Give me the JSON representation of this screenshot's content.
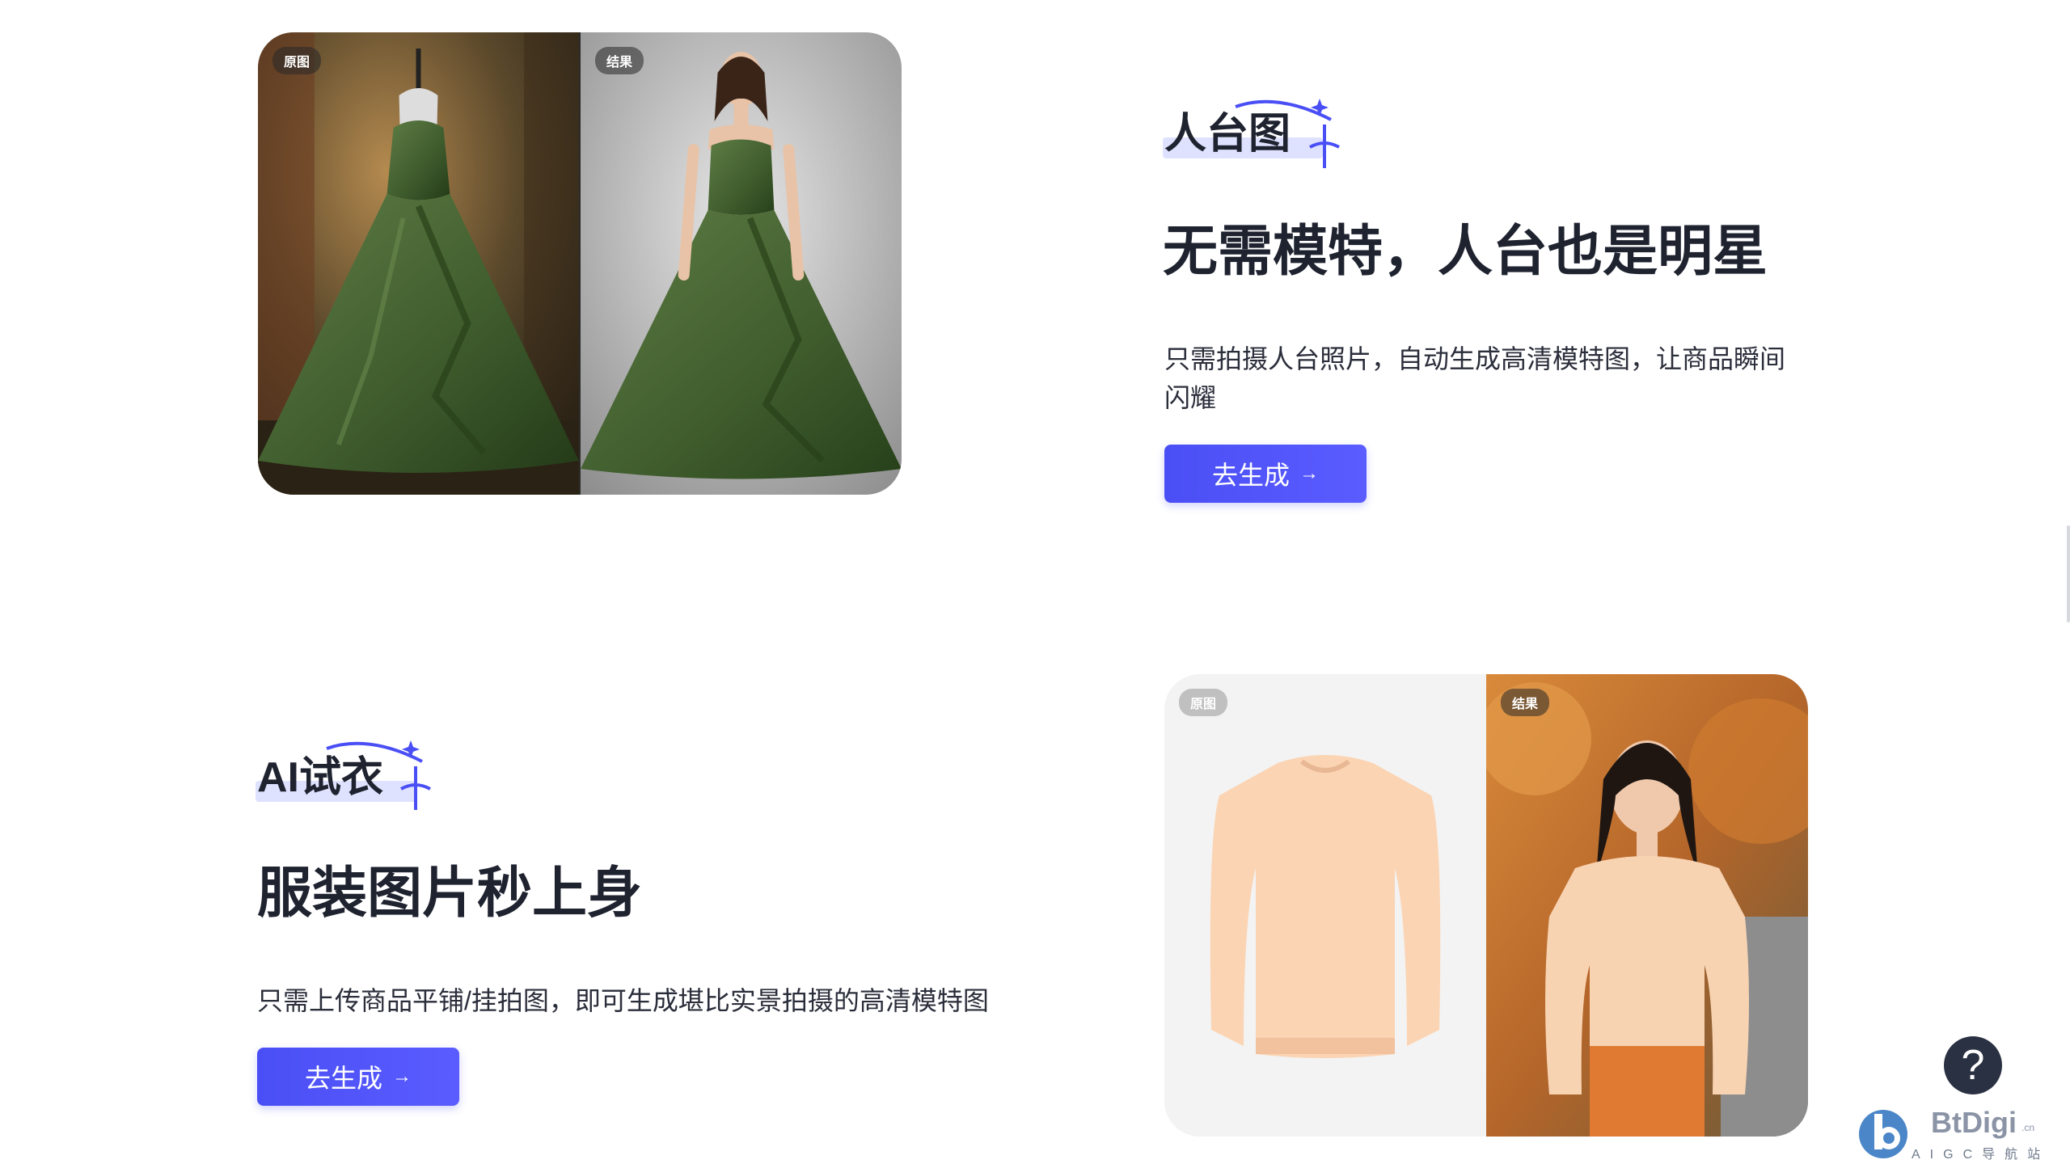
{
  "features": [
    {
      "title": "人台图",
      "headline": "无需模特，人台也是明星",
      "description": "只需拍摄人台照片，自动生成高清模特图，让商品瞬间闪耀",
      "cta": "去生成",
      "cta_arrow": "→",
      "before_label": "原图",
      "after_label": "结果"
    },
    {
      "title": "AI试衣",
      "headline": "服装图片秒上身",
      "description": "只需上传商品平铺/挂拍图，即可生成堪比实景拍摄的高清模特图",
      "cta": "去生成",
      "cta_arrow": "→",
      "before_label": "原图",
      "after_label": "结果"
    }
  ],
  "help_button": "?",
  "watermark": {
    "brand": "BtDigi",
    "domain": ".cn",
    "subtitle": "AIGC导航站"
  },
  "colors": {
    "accent": "#4a4ff5",
    "heading": "#1f2330",
    "help_bg": "#2a3142"
  }
}
